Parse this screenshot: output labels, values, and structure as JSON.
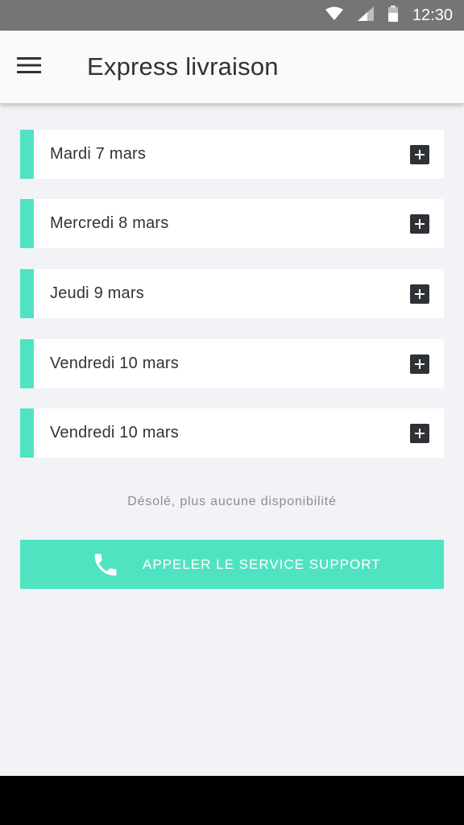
{
  "status_bar": {
    "time": "12:30",
    "icons": [
      "wifi-icon",
      "signal-icon",
      "battery-icon"
    ]
  },
  "app_bar": {
    "title": "Express livraison",
    "menu_icon": "hamburger-menu-icon"
  },
  "days": [
    {
      "label": "Mardi 7 mars",
      "icon": "plus-icon"
    },
    {
      "label": "Mercredi 8 mars",
      "icon": "plus-icon"
    },
    {
      "label": "Jeudi 9 mars",
      "icon": "plus-icon"
    },
    {
      "label": "Vendredi 10 mars",
      "icon": "plus-icon"
    },
    {
      "label": "Vendredi 10 mars",
      "icon": "plus-icon"
    }
  ],
  "availability_message": "Désolé, plus aucune disponibilité",
  "support_button": {
    "label": "APPELER LE SERVICE SUPPORT",
    "icon": "phone-icon"
  },
  "colors": {
    "accent": "#50e3c2",
    "background": "#f2f3f7",
    "text": "#30333a",
    "status_bar": "#757575"
  }
}
